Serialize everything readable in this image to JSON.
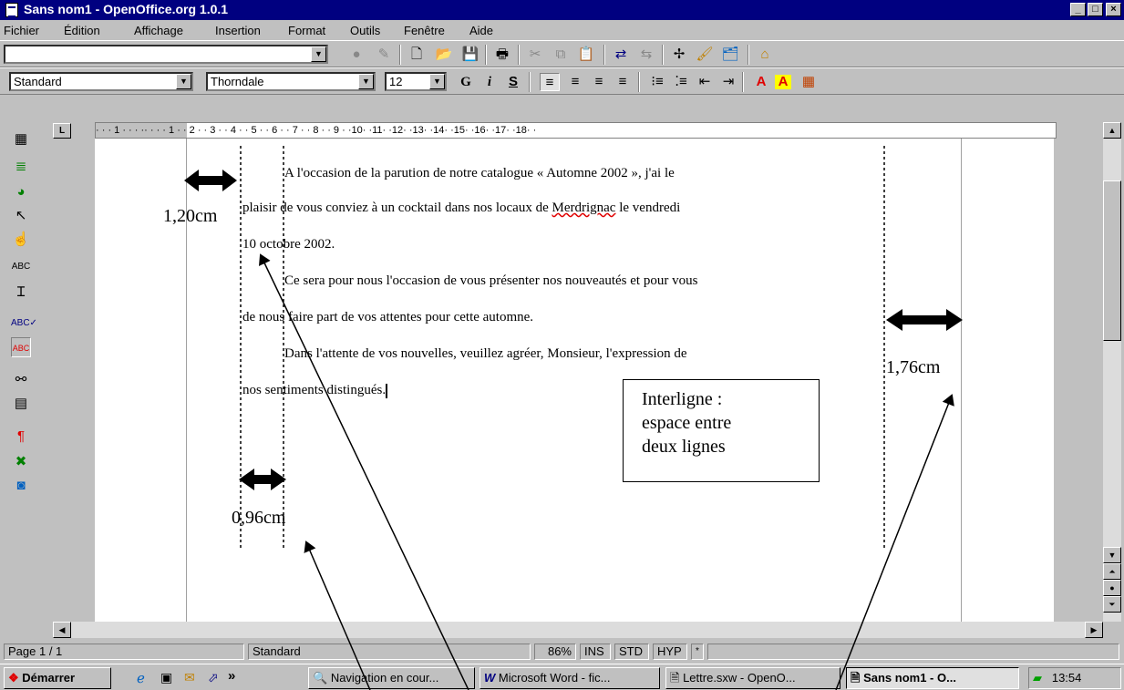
{
  "window": {
    "title": "Sans nom1 - OpenOffice.org 1.0.1",
    "min": "_",
    "max": "□",
    "close": "×"
  },
  "menu": [
    "Fichier",
    "Édition",
    "Affichage",
    "Insertion",
    "Format",
    "Outils",
    "Fenêtre",
    "Aide"
  ],
  "format_toolbar": {
    "style": "Standard",
    "font": "Thorndale",
    "size": "12",
    "bold": "G",
    "italic": "i",
    "underline": "S"
  },
  "ruler": {
    "text": "· · · 1 · · · ·· · · · 1 · · 2 · · 3 · · 4 · · 5 · · 6 · · 7 · · 8 · · 9 · ·10· ·11· ·12· ·13· ·14· ·15· ·16· ·17· ·18· ·"
  },
  "document": {
    "lines": [
      "A l'occasion de la parution de notre catalogue « Automne 2002 », j'ai le",
      "plaisir de vous conviez à un cocktail dans nos locaux de ",
      "10 octobre 2002.",
      "Ce sera pour nous l'occasion de vous présenter nos nouveautés et pour vous",
      "de nous faire part de vos attentes pour cette automne.",
      "Dans l'attente de vos nouvelles, veuillez agréer, Monsieur, l'expression de",
      "nos sentiments distingués."
    ],
    "misspelled": "Merdrignac",
    "line2_tail": " le vendredi"
  },
  "annotations": {
    "left_margin": "1,20cm",
    "right_margin": "1,76cm",
    "indent": "0,96cm",
    "box_line1": "Interligne :",
    "box_line2": "espace entre",
    "box_line3": "deux lignes"
  },
  "status": {
    "page": "Page 1 / 1",
    "style": "Standard",
    "zoom": "86%",
    "ins": "INS",
    "std": "STD",
    "hyp": "HYP",
    "star": "*"
  },
  "taskbar": {
    "start": "Démarrer",
    "chevron": "»",
    "tasks": [
      "Navigation en cour...",
      "Microsoft Word - fic...",
      "Lettre.sxw - OpenO...",
      "Sans nom1 - O..."
    ],
    "clock": "13:54"
  }
}
